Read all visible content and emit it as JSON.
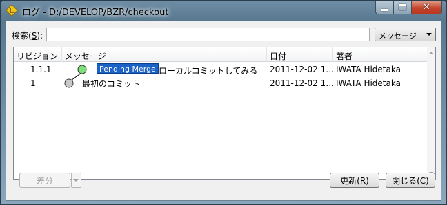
{
  "window": {
    "title": "ログ - D:/DEVELOP/BZR/checkout",
    "icon": "bazaar-diamond-icon",
    "controls": {
      "minimize": "minimize-icon",
      "maximize": "maximize-icon",
      "close_label": "✕"
    }
  },
  "search": {
    "label_prefix": "検索(",
    "label_mnemonic": "S",
    "label_suffix": "):",
    "value": "",
    "field_selected": "メッセージ"
  },
  "log": {
    "columns": [
      "リビジョン",
      "メッセージ",
      "日付",
      "著者"
    ],
    "rows": [
      {
        "revision": "1.1.1",
        "tag": "Pending Merge",
        "message": "ローカルコミットしてみる",
        "date": "2011-12-02 1…",
        "author": "IWATA Hidetaka",
        "node_color": "#7ee07a"
      },
      {
        "revision": "1",
        "tag": "",
        "message": "最初のコミット",
        "date": "2011-12-02 1…",
        "author": "IWATA Hidetaka",
        "node_color": "#c8c8c8"
      }
    ]
  },
  "buttons": {
    "diff": "差分",
    "refresh": "更新(R)",
    "close": "閉じる(C)"
  }
}
